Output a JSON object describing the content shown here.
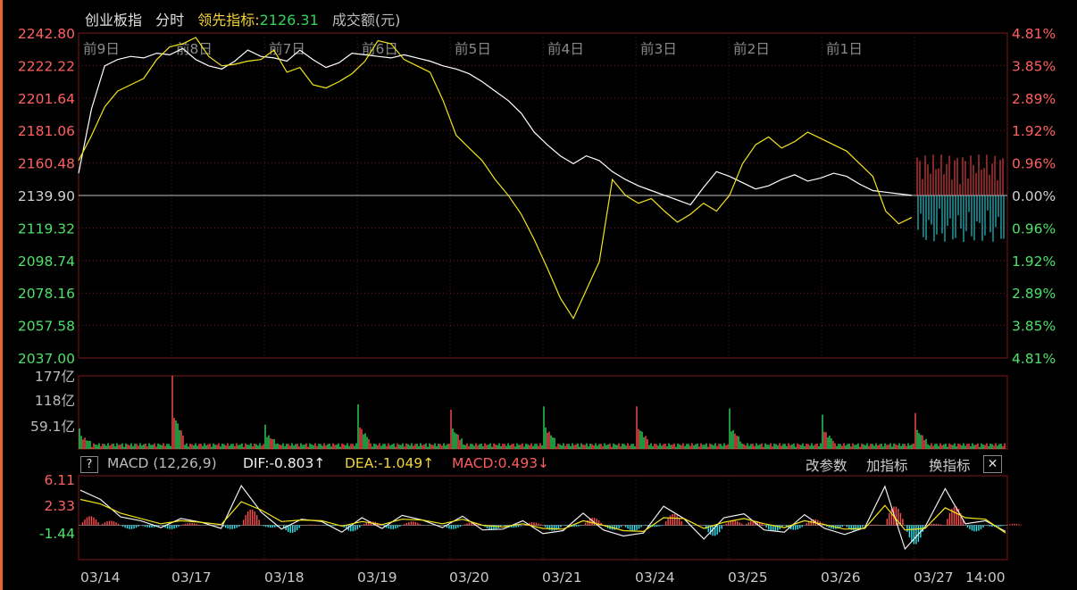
{
  "header": {
    "title": "创业板指",
    "mode": "分时",
    "leading_label": "领先指标:",
    "leading_value": "2126.31",
    "volume_label": "成交额(元)"
  },
  "chart_data": [
    {
      "type": "line",
      "ylim": [
        2037.0,
        2242.8
      ],
      "y_ticks": [
        "2242.80",
        "2222.22",
        "2201.64",
        "2181.06",
        "2160.48",
        "2139.90",
        "2119.32",
        "2098.74",
        "2078.16",
        "2057.58",
        "2037.00"
      ],
      "pct_ticks": [
        "4.81%",
        "3.85%",
        "2.89%",
        "1.92%",
        "0.96%",
        "0.00%",
        "0.96%",
        "1.92%",
        "2.89%",
        "3.85%",
        "4.81%"
      ],
      "day_labels": [
        "前9日",
        "前8日",
        "前7日",
        "前6日",
        "前5日",
        "前4日",
        "前3日",
        "前2日",
        "前1日"
      ],
      "reference": 2139.9,
      "series": [
        {
          "color": "#ffffff",
          "values": [
            2154,
            2195,
            2222,
            2226,
            2228,
            2227,
            2230,
            2229,
            2233,
            2226,
            2222,
            2220,
            2225,
            2232,
            2228,
            2227,
            2225,
            2232,
            2226,
            2221,
            2224,
            2230,
            2229,
            2228,
            2227,
            2229,
            2227,
            2225,
            2222,
            2220,
            2217,
            2212,
            2206,
            2200,
            2192,
            2180,
            2172,
            2165,
            2160,
            2165,
            2162,
            2155,
            2150,
            2146,
            2143,
            2140,
            2137,
            2134,
            2145,
            2155,
            2152,
            2148,
            2144,
            2146,
            2150,
            2153,
            2149,
            2151,
            2154,
            2152,
            2147,
            2143,
            2142,
            2141,
            2140
          ]
        },
        {
          "color": "#f3e51a",
          "values": [
            2162,
            2178,
            2196,
            2206,
            2210,
            2214,
            2226,
            2234,
            2236,
            2240,
            2228,
            2222,
            2223,
            2225,
            2226,
            2232,
            2218,
            2221,
            2210,
            2208,
            2212,
            2217,
            2225,
            2238,
            2236,
            2226,
            2222,
            2218,
            2200,
            2178,
            2170,
            2162,
            2150,
            2140,
            2128,
            2112,
            2094,
            2075,
            2062,
            2080,
            2098,
            2150,
            2140,
            2135,
            2138,
            2130,
            2123,
            2128,
            2135,
            2130,
            2140,
            2160,
            2172,
            2177,
            2170,
            2174,
            2180,
            2176,
            2172,
            2168,
            2160,
            2152,
            2130,
            2122,
            2126
          ]
        }
      ]
    },
    {
      "type": "bar",
      "title": "成交额",
      "y_ticks": [
        "177亿",
        "118亿",
        "59.1亿"
      ],
      "ylim": [
        0,
        177
      ],
      "spike_values": [
        50,
        177,
        59,
        108,
        95,
        103,
        103,
        98,
        83,
        87,
        67
      ]
    },
    {
      "type": "bar",
      "title": "MACD",
      "y_ticks": [
        "6.11",
        "2.33",
        "-1.44"
      ],
      "ylim": [
        -4.5,
        6.5
      ],
      "dif": [
        4.6,
        3.4,
        1.1,
        0.6,
        -0.3,
        0.9,
        0.4,
        -0.4,
        5.2,
        1.7,
        -0.5,
        0.8,
        0.5,
        -0.9,
        1.0,
        -0.4,
        1.3,
        0.7,
        -0.3,
        1.2,
        -0.6,
        -0.5,
        0.6,
        -1.1,
        -0.7,
        1.6,
        -0.6,
        -1.4,
        -1.0,
        2.5,
        0.9,
        -1.8,
        1.0,
        1.5,
        -0.6,
        -0.9,
        1.4,
        -0.4,
        -1.2,
        -0.3,
        5.1,
        -3.1,
        -0.2,
        4.8,
        0.2,
        0.6,
        -0.8
      ],
      "dea": [
        3.4,
        2.8,
        1.6,
        0.9,
        0.2,
        0.6,
        0.4,
        0.1,
        3.1,
        2.0,
        0.5,
        0.7,
        0.6,
        -0.1,
        0.5,
        0.1,
        0.8,
        0.7,
        0.2,
        0.8,
        0.0,
        -0.2,
        0.2,
        -0.4,
        -0.5,
        0.6,
        0.0,
        -0.7,
        -0.8,
        1.0,
        0.9,
        -0.4,
        0.4,
        0.9,
        0.2,
        -0.3,
        0.6,
        0.1,
        -0.5,
        -0.4,
        2.6,
        -0.6,
        -0.4,
        2.3,
        1.0,
        0.8,
        -1.0
      ],
      "macd": [
        1.2,
        0.6,
        -0.5,
        -0.3,
        -0.5,
        0.3,
        0.0,
        -0.5,
        2.1,
        -0.3,
        -1.0,
        0.1,
        -0.1,
        -0.8,
        0.5,
        -0.5,
        0.5,
        0.0,
        -0.5,
        0.4,
        -0.6,
        -0.3,
        0.4,
        -0.7,
        -0.2,
        1.0,
        -0.6,
        -0.7,
        -0.2,
        1.5,
        0.0,
        -1.4,
        0.6,
        0.6,
        -0.8,
        -0.6,
        0.8,
        -0.5,
        -0.7,
        0.1,
        2.5,
        -2.5,
        0.2,
        2.5,
        -0.8,
        -0.2,
        0.2
      ]
    }
  ],
  "macd_panel": {
    "help": "?",
    "name": "MACD (12,26,9)",
    "dif": "DIF:-0.803↑",
    "dea": "DEA:-1.049↑",
    "macd": "MACD:0.493↓",
    "btn_params": "改参数",
    "btn_add": "加指标",
    "btn_switch": "换指标",
    "btn_close": "✕"
  },
  "x_axis": [
    "03/14",
    "03/17",
    "03/18",
    "03/19",
    "03/20",
    "03/21",
    "03/24",
    "03/25",
    "03/26",
    "03/27",
    "14:00"
  ],
  "colors": {
    "up": "#ff4d4d",
    "down": "#2fd35a",
    "teal": "#2ee6f0",
    "leading": "#f3e51a",
    "price": "#ffffff",
    "grid": "#7a1818"
  }
}
